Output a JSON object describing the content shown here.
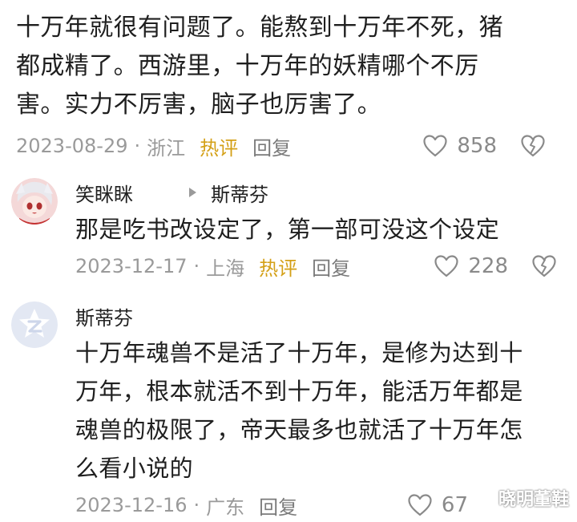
{
  "main_comment": {
    "text_lines": [
      "十万年就很有问题了。能熬到十万年不死，猪",
      "都成精了。西游里，十万年的妖精哪个不厉",
      "害。实力不厉害，脑子也厉害了。"
    ],
    "date": "2023-08-29",
    "location": "浙江",
    "hot_label": "热评",
    "reply_label": "回复",
    "like_count": "858"
  },
  "replies": [
    {
      "username": "笑眯眯",
      "reply_to": "斯蒂芬",
      "text_lines": [
        "那是吃书改设定了，第一部可没这个设定"
      ],
      "date": "2023-12-17",
      "location": "上海",
      "hot_label": "热评",
      "reply_label": "回复",
      "like_count": "228"
    },
    {
      "username": "斯蒂芬",
      "text_lines": [
        "十万年魂兽不是活了十万年，是修为达到十",
        "万年，根本就活不到十万年，能活万年都是",
        "魂兽的极限了，帝天最多也就活了十万年怎",
        "么看小说的"
      ],
      "date": "2023-12-16",
      "location": "广东",
      "reply_label": "回复",
      "like_count": "67"
    }
  ],
  "separator": "·",
  "watermark": "晓明董鞋",
  "icons": {
    "like": "heart-outline-icon",
    "dislike": "broken-heart-icon",
    "reply_arrow": "triangle-right-icon"
  },
  "colors": {
    "hot": "#d4a017",
    "meta": "#9a9a9a",
    "text": "#1f1f1f"
  }
}
